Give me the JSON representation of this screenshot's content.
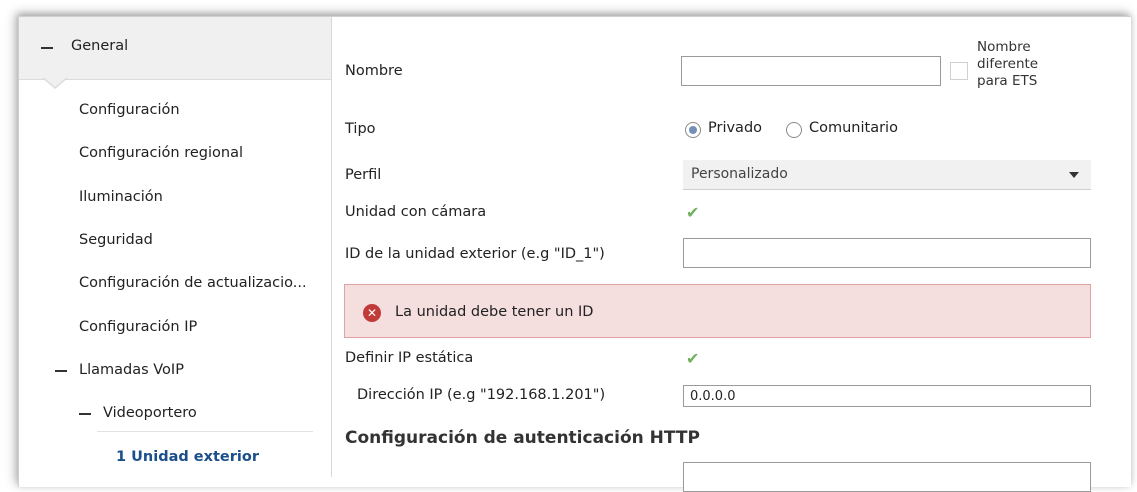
{
  "sidebar": {
    "general_label": "General",
    "items": [
      {
        "label": "Configuración"
      },
      {
        "label": "Configuración regional"
      },
      {
        "label": "Iluminación"
      },
      {
        "label": "Seguridad"
      },
      {
        "label": "Configuración de actualizacio..."
      },
      {
        "label": "Configuración IP"
      }
    ],
    "voip_label": "Llamadas VoIP",
    "videoportero_label": "Videoportero",
    "selected_label": "1 Unidad exterior"
  },
  "form": {
    "nombre_label": "Nombre",
    "nombre_value": "",
    "nombre_diferente_label": "Nombre diferente para ETS",
    "tipo_label": "Tipo",
    "tipo_options": [
      "Privado",
      "Comunitario"
    ],
    "tipo_selected": "Privado",
    "perfil_label": "Perfil",
    "perfil_value": "Personalizado",
    "camara_label": "Unidad con cámara",
    "camara_checked": true,
    "id_label": "ID de la unidad exterior (e.g \"ID_1\")",
    "id_value": "",
    "error_text": "La unidad debe tener un ID",
    "ip_estatica_label": "Definir IP estática",
    "ip_estatica_checked": true,
    "direccion_label": "Dirección IP (e.g \"192.168.1.201\")",
    "direccion_value": "0.0.0.0",
    "http_section_title": "Configuración de autenticación HTTP"
  },
  "icons": {
    "check": "check-icon",
    "error": "error-icon",
    "collapse": "minus-icon",
    "dropdown": "chevron-down-icon"
  },
  "colors": {
    "check": "#6fb05c",
    "error_bg": "#f5dede",
    "error_icon": "#c23b3b",
    "selected_text": "#1a4f8b",
    "radio_fill": "#7590b8"
  }
}
